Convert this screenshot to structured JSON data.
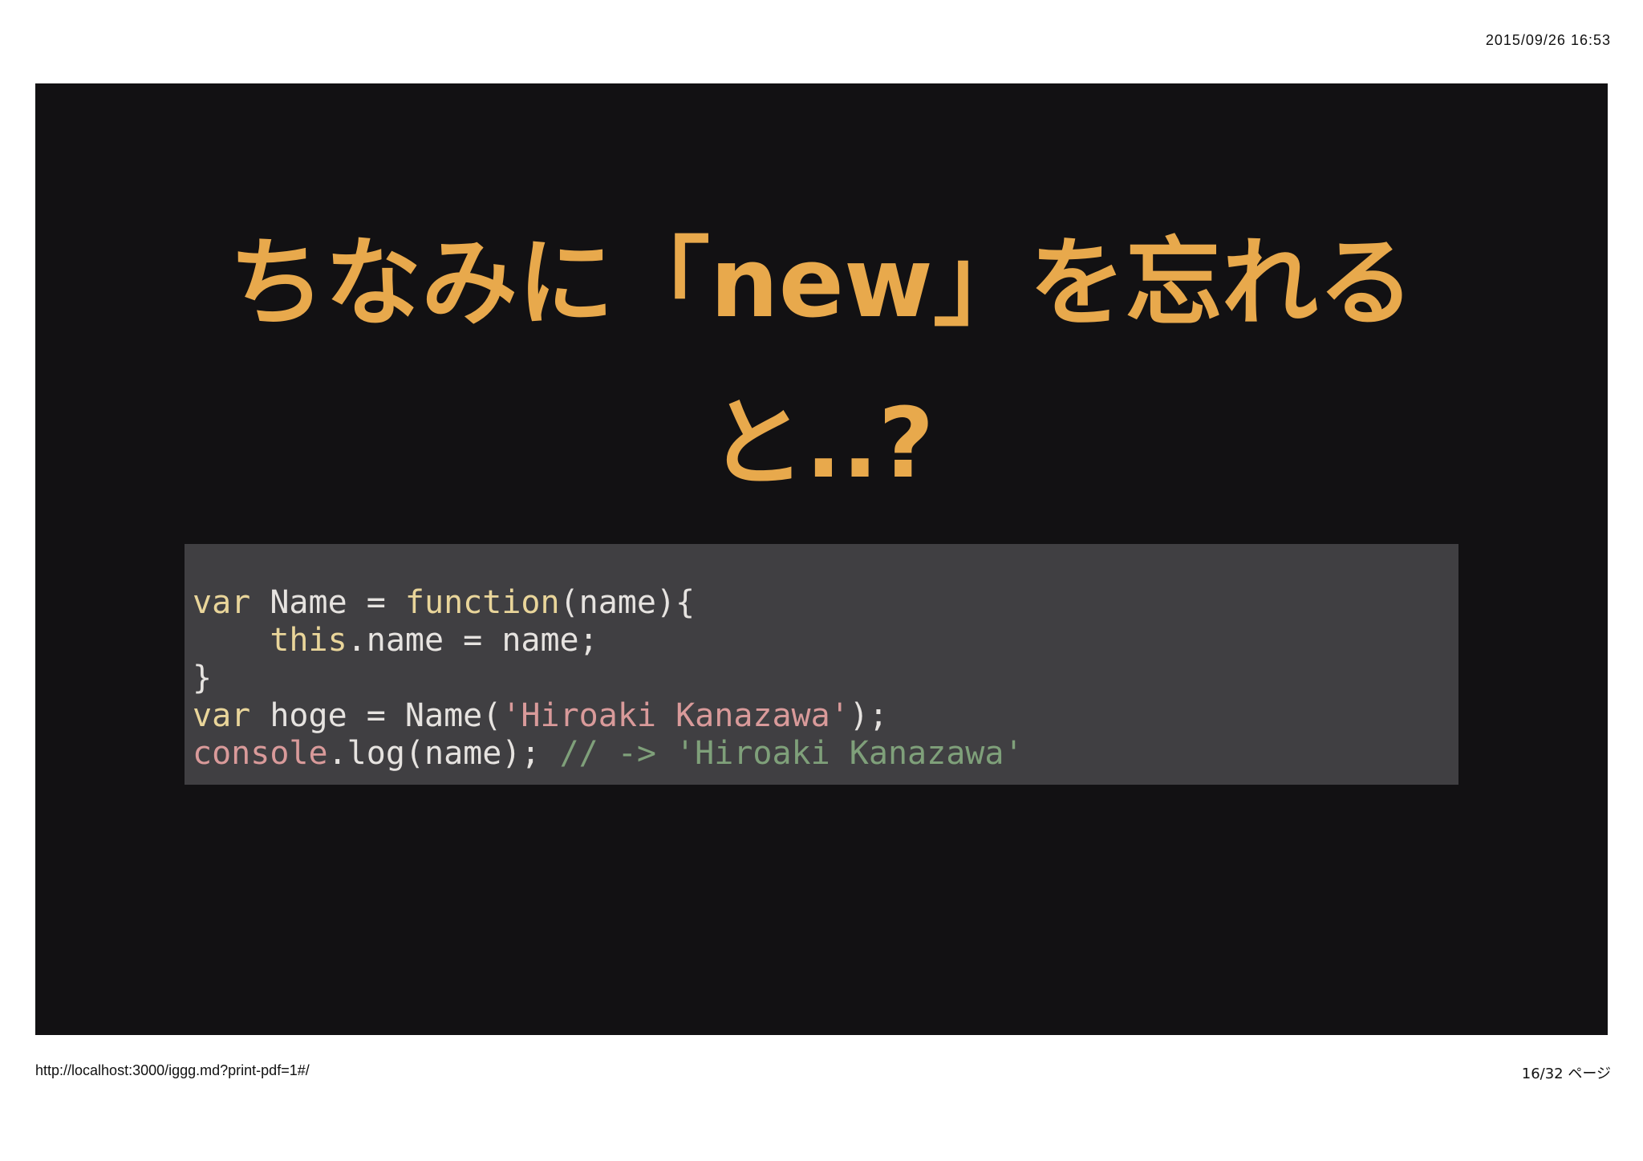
{
  "header": {
    "print_date": "2015/09/26 16:53"
  },
  "slide": {
    "title_line1": "ちなみに「new」を忘れる",
    "title_line2": "と..?",
    "colors": {
      "background": "#121113",
      "title": "#e8a94c",
      "code_background": "#403f42",
      "keyword": "#e9d59a",
      "string": "#d99a9a",
      "comment": "#7fa07a"
    },
    "code": {
      "lines": [
        [
          {
            "t": "var",
            "c": "kw"
          },
          {
            "t": " Name = ",
            "c": "plain"
          },
          {
            "t": "function",
            "c": "kw"
          },
          {
            "t": "(name){",
            "c": "plain"
          }
        ],
        [
          {
            "t": "    ",
            "c": "plain"
          },
          {
            "t": "this",
            "c": "kw"
          },
          {
            "t": ".name = name;",
            "c": "plain"
          }
        ],
        [
          {
            "t": "}",
            "c": "plain"
          }
        ],
        [
          {
            "t": "var",
            "c": "kw"
          },
          {
            "t": " hoge = Name(",
            "c": "plain"
          },
          {
            "t": "'Hiroaki Kanazawa'",
            "c": "str"
          },
          {
            "t": ");",
            "c": "plain"
          }
        ],
        [
          {
            "t": "console",
            "c": "console"
          },
          {
            "t": ".log(name); ",
            "c": "plain"
          },
          {
            "t": "// -> 'Hiroaki Kanazawa'",
            "c": "comment"
          }
        ]
      ]
    }
  },
  "footer": {
    "url": "http://localhost:3000/iggg.md?print-pdf=1#/",
    "page": "16/32 ページ"
  }
}
